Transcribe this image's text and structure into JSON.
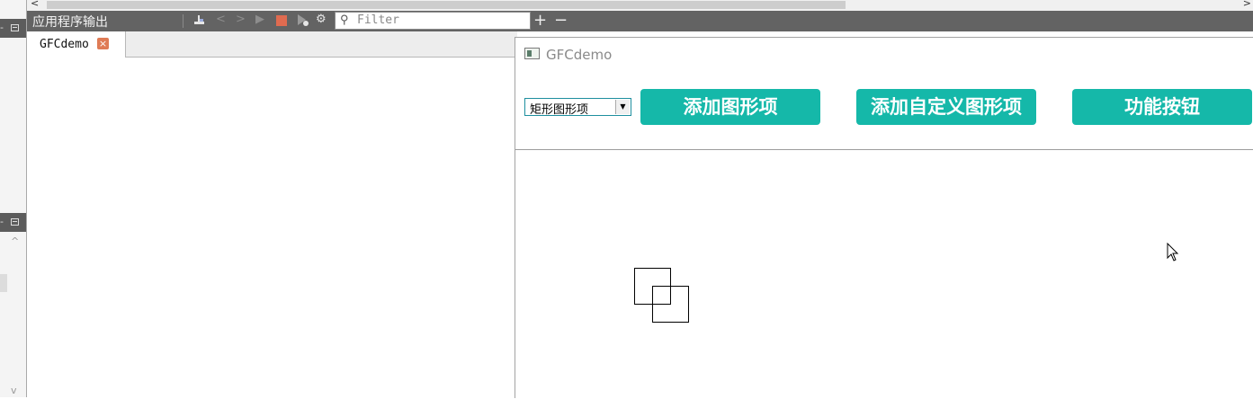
{
  "output_pane": {
    "title": "应用程序输出",
    "filter_placeholder": "Filter",
    "add_label": "+",
    "remove_label": "−",
    "icons": [
      "clear-icon",
      "prev-icon",
      "next-icon",
      "run-icon",
      "stop-icon",
      "debug-run-icon",
      "settings-icon",
      "search-icon"
    ]
  },
  "tab": {
    "label": "GFCdemo",
    "close_label": "×"
  },
  "app": {
    "title": "GFCdemo",
    "combo_value": "矩形图形项",
    "buttons": {
      "add_item": "添加图形项",
      "add_custom_item": "添加自定义图形项",
      "function": "功能按钮"
    },
    "accent_color": "#15b8a9"
  }
}
